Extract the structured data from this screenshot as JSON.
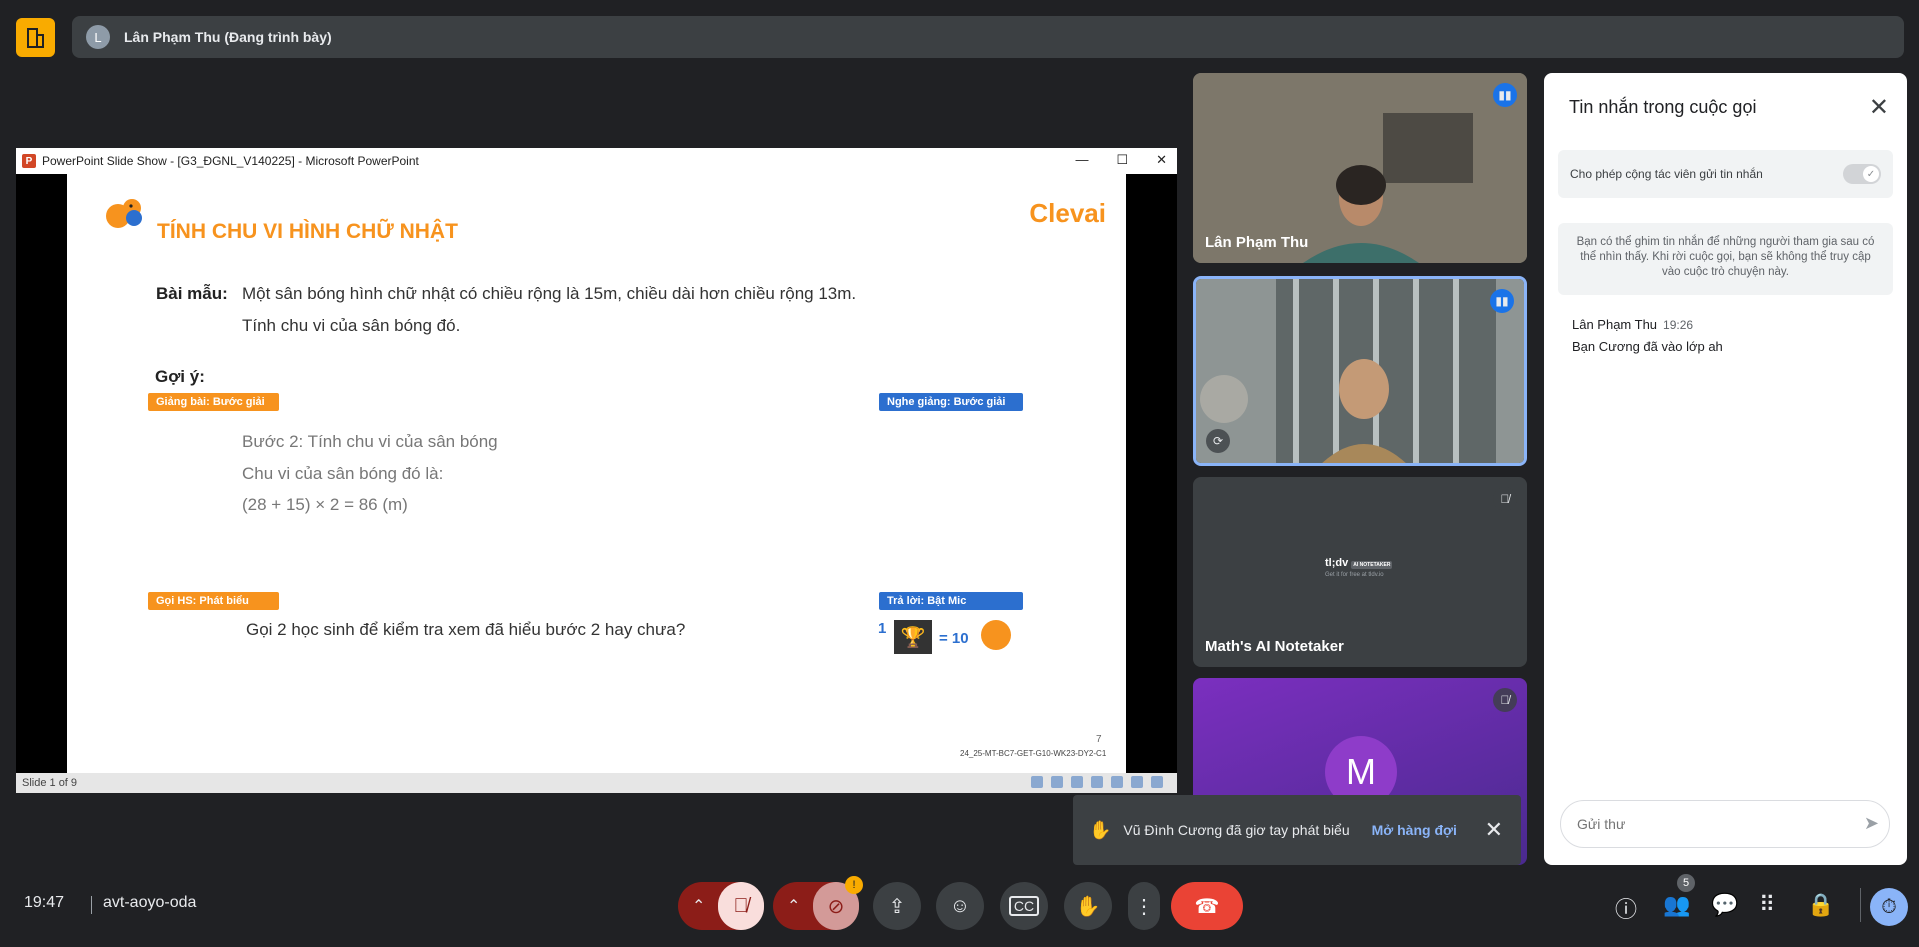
{
  "header": {
    "presenter_initial": "L",
    "presenter_text": "Lân Phạm Thu (Đang trình bày)"
  },
  "ppt": {
    "window_title": "PowerPoint Slide Show - [G3_ĐGNL_V140225] - Microsoft PowerPoint",
    "status": "Slide 1 of 9",
    "slide": {
      "title": "TÍNH CHU VI HÌNH CHỮ NHẬT",
      "brand": "Clevai",
      "bai_mau_label": "Bài mẫu:",
      "bai_mau_line1": "Một sân bóng hình chữ nhật có chiều rộng là 15m, chiều dài hơn chiều rộng 13m.",
      "bai_mau_line2": "Tính chu vi của sân bóng đó.",
      "goi_y_label": "Gợi ý:",
      "tag_giang_bai": "Giảng bài: Bước giải",
      "tag_nghe_giang": "Nghe giảng: Bước giải",
      "step_line1": "Bước 2: Tính chu vi của sân bóng",
      "step_line2": "Chu vi của sân bóng đó là:",
      "step_line3": "(28 + 15) × 2 = 86 (m)",
      "tag_goi_hs": "Gọi HS: Phát biểu",
      "tag_tra_loi": "Trả lời: Bật Mic",
      "question": "Gọi 2 học sinh để kiểm tra xem đã hiểu bước 2 hay chưa?",
      "reward_count": "1",
      "reward_equals": "= 10",
      "page_number": "7",
      "footer_code": "24_25-MT-BC7-GET-G10-WK23-DY2-C1"
    }
  },
  "tiles": [
    {
      "name": "Lân Phạm Thu"
    },
    {
      "name": ""
    },
    {
      "name": "Math's AI Notetaker",
      "logo_text": "tl;dv",
      "logo_badge": "AI NOTETAKER",
      "logo_sub": "Get it for free at tldv.io"
    },
    {
      "name": "",
      "avatar_letter": "M"
    }
  ],
  "chat": {
    "title": "Tin nhắn trong cuộc gọi",
    "permission_label": "Cho phép cộng tác viên gửi tin nhắn",
    "info": "Bạn có thể ghim tin nhắn để những người tham gia sau có thể nhìn thấy. Khi rời cuộc gọi, bạn sẽ không thể truy cập vào cuộc trò chuyện này.",
    "messages": [
      {
        "sender": "Lân Phạm Thu",
        "time": "19:26",
        "text": "Bạn Cương đã vào lớp ah"
      }
    ],
    "input_placeholder": "Gửi thư"
  },
  "toast": {
    "text": "Vũ Đình Cương đã giơ tay phát biểu",
    "link": "Mở hàng đợi"
  },
  "bottom": {
    "time": "19:47",
    "meeting_code": "avt-aoyo-oda",
    "participants_count": "5",
    "camera_warning": "!"
  }
}
